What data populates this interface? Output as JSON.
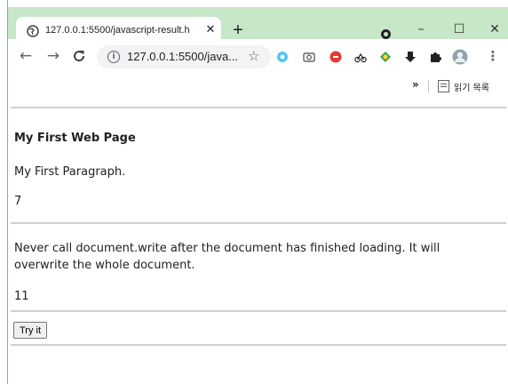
{
  "browser": {
    "tab_title": "127.0.0.1:5500/javascript-result.h",
    "new_tab_symbol": "+",
    "url": "127.0.0.1:5500/java...",
    "window_controls": {
      "minimize": "–",
      "maximize": "☐",
      "close": "✕"
    },
    "bookmarks": {
      "overflow": "»",
      "reading_list_label": "읽기 목록"
    }
  },
  "page": {
    "heading": "My First Web Page",
    "paragraph": "My First Paragraph.",
    "result1": "7",
    "message": "Never call document.write after the document has finished loading. It will overwrite the whole document.",
    "result2": "11",
    "button_label": "Try it"
  },
  "colors": {
    "tabstrip": "#c7e7c8",
    "rule": "#cfcfcf"
  }
}
